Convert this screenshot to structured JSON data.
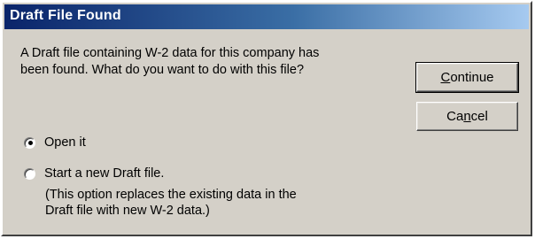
{
  "dialog": {
    "title": "Draft File Found",
    "message": "A Draft file containing W-2 data for this company has\nbeen found. What do you want to do with this file?",
    "buttons": {
      "continue": {
        "prefix": "",
        "mnemonic": "C",
        "suffix": "ontinue"
      },
      "cancel": {
        "prefix": "Ca",
        "mnemonic": "n",
        "suffix": "cel"
      }
    },
    "options": [
      {
        "label": "Open it",
        "selected": true
      },
      {
        "label": "Start a new Draft file.",
        "selected": false
      }
    ],
    "note": "(This option replaces the existing data in the\nDraft file with new W-2 data.)"
  }
}
